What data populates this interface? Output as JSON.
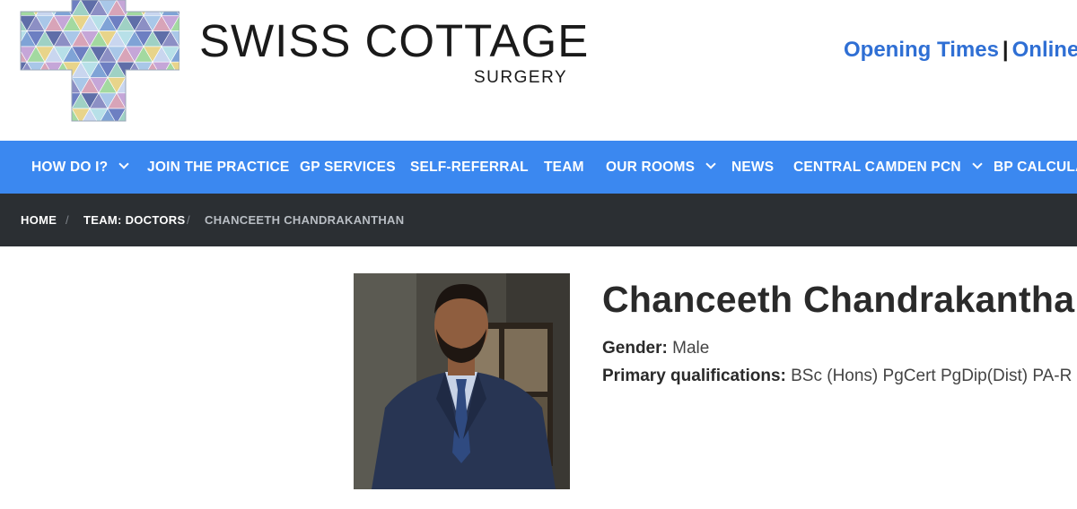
{
  "header": {
    "logo_title": "SWISS COTTAGE",
    "logo_subtitle": "SURGERY",
    "links": [
      {
        "label": "Opening Times"
      },
      {
        "label": "Online"
      }
    ],
    "link_separator": "|",
    "link_color": "#2f6fd4"
  },
  "nav": {
    "background": "#3b88f0",
    "items": [
      {
        "label": "HOW DO I?",
        "dropdown": true
      },
      {
        "label": "JOIN THE PRACTICE",
        "dropdown": false
      },
      {
        "label": "GP SERVICES",
        "dropdown": false
      },
      {
        "label": "SELF-REFERRAL",
        "dropdown": false
      },
      {
        "label": "TEAM",
        "dropdown": false
      },
      {
        "label": "OUR ROOMS",
        "dropdown": true
      },
      {
        "label": "NEWS",
        "dropdown": false
      },
      {
        "label": "CENTRAL CAMDEN PCN",
        "dropdown": true
      },
      {
        "label": "BP CALCULATOR",
        "dropdown": false
      }
    ]
  },
  "breadcrumb": {
    "background": "#2b2f33",
    "items": [
      {
        "label": "HOME"
      },
      {
        "label": "TEAM: DOCTORS"
      },
      {
        "label": "CHANCEETH CHANDRAKANTHAN"
      }
    ],
    "separator": "/"
  },
  "profile": {
    "name": "Chanceeth Chandrakanthan",
    "gender_label": "Gender:",
    "gender_value": "Male",
    "qualifications_label": "Primary qualifications:",
    "qualifications_value": "BSc (Hons) PgCert PgDip(Dist) PA-R"
  }
}
